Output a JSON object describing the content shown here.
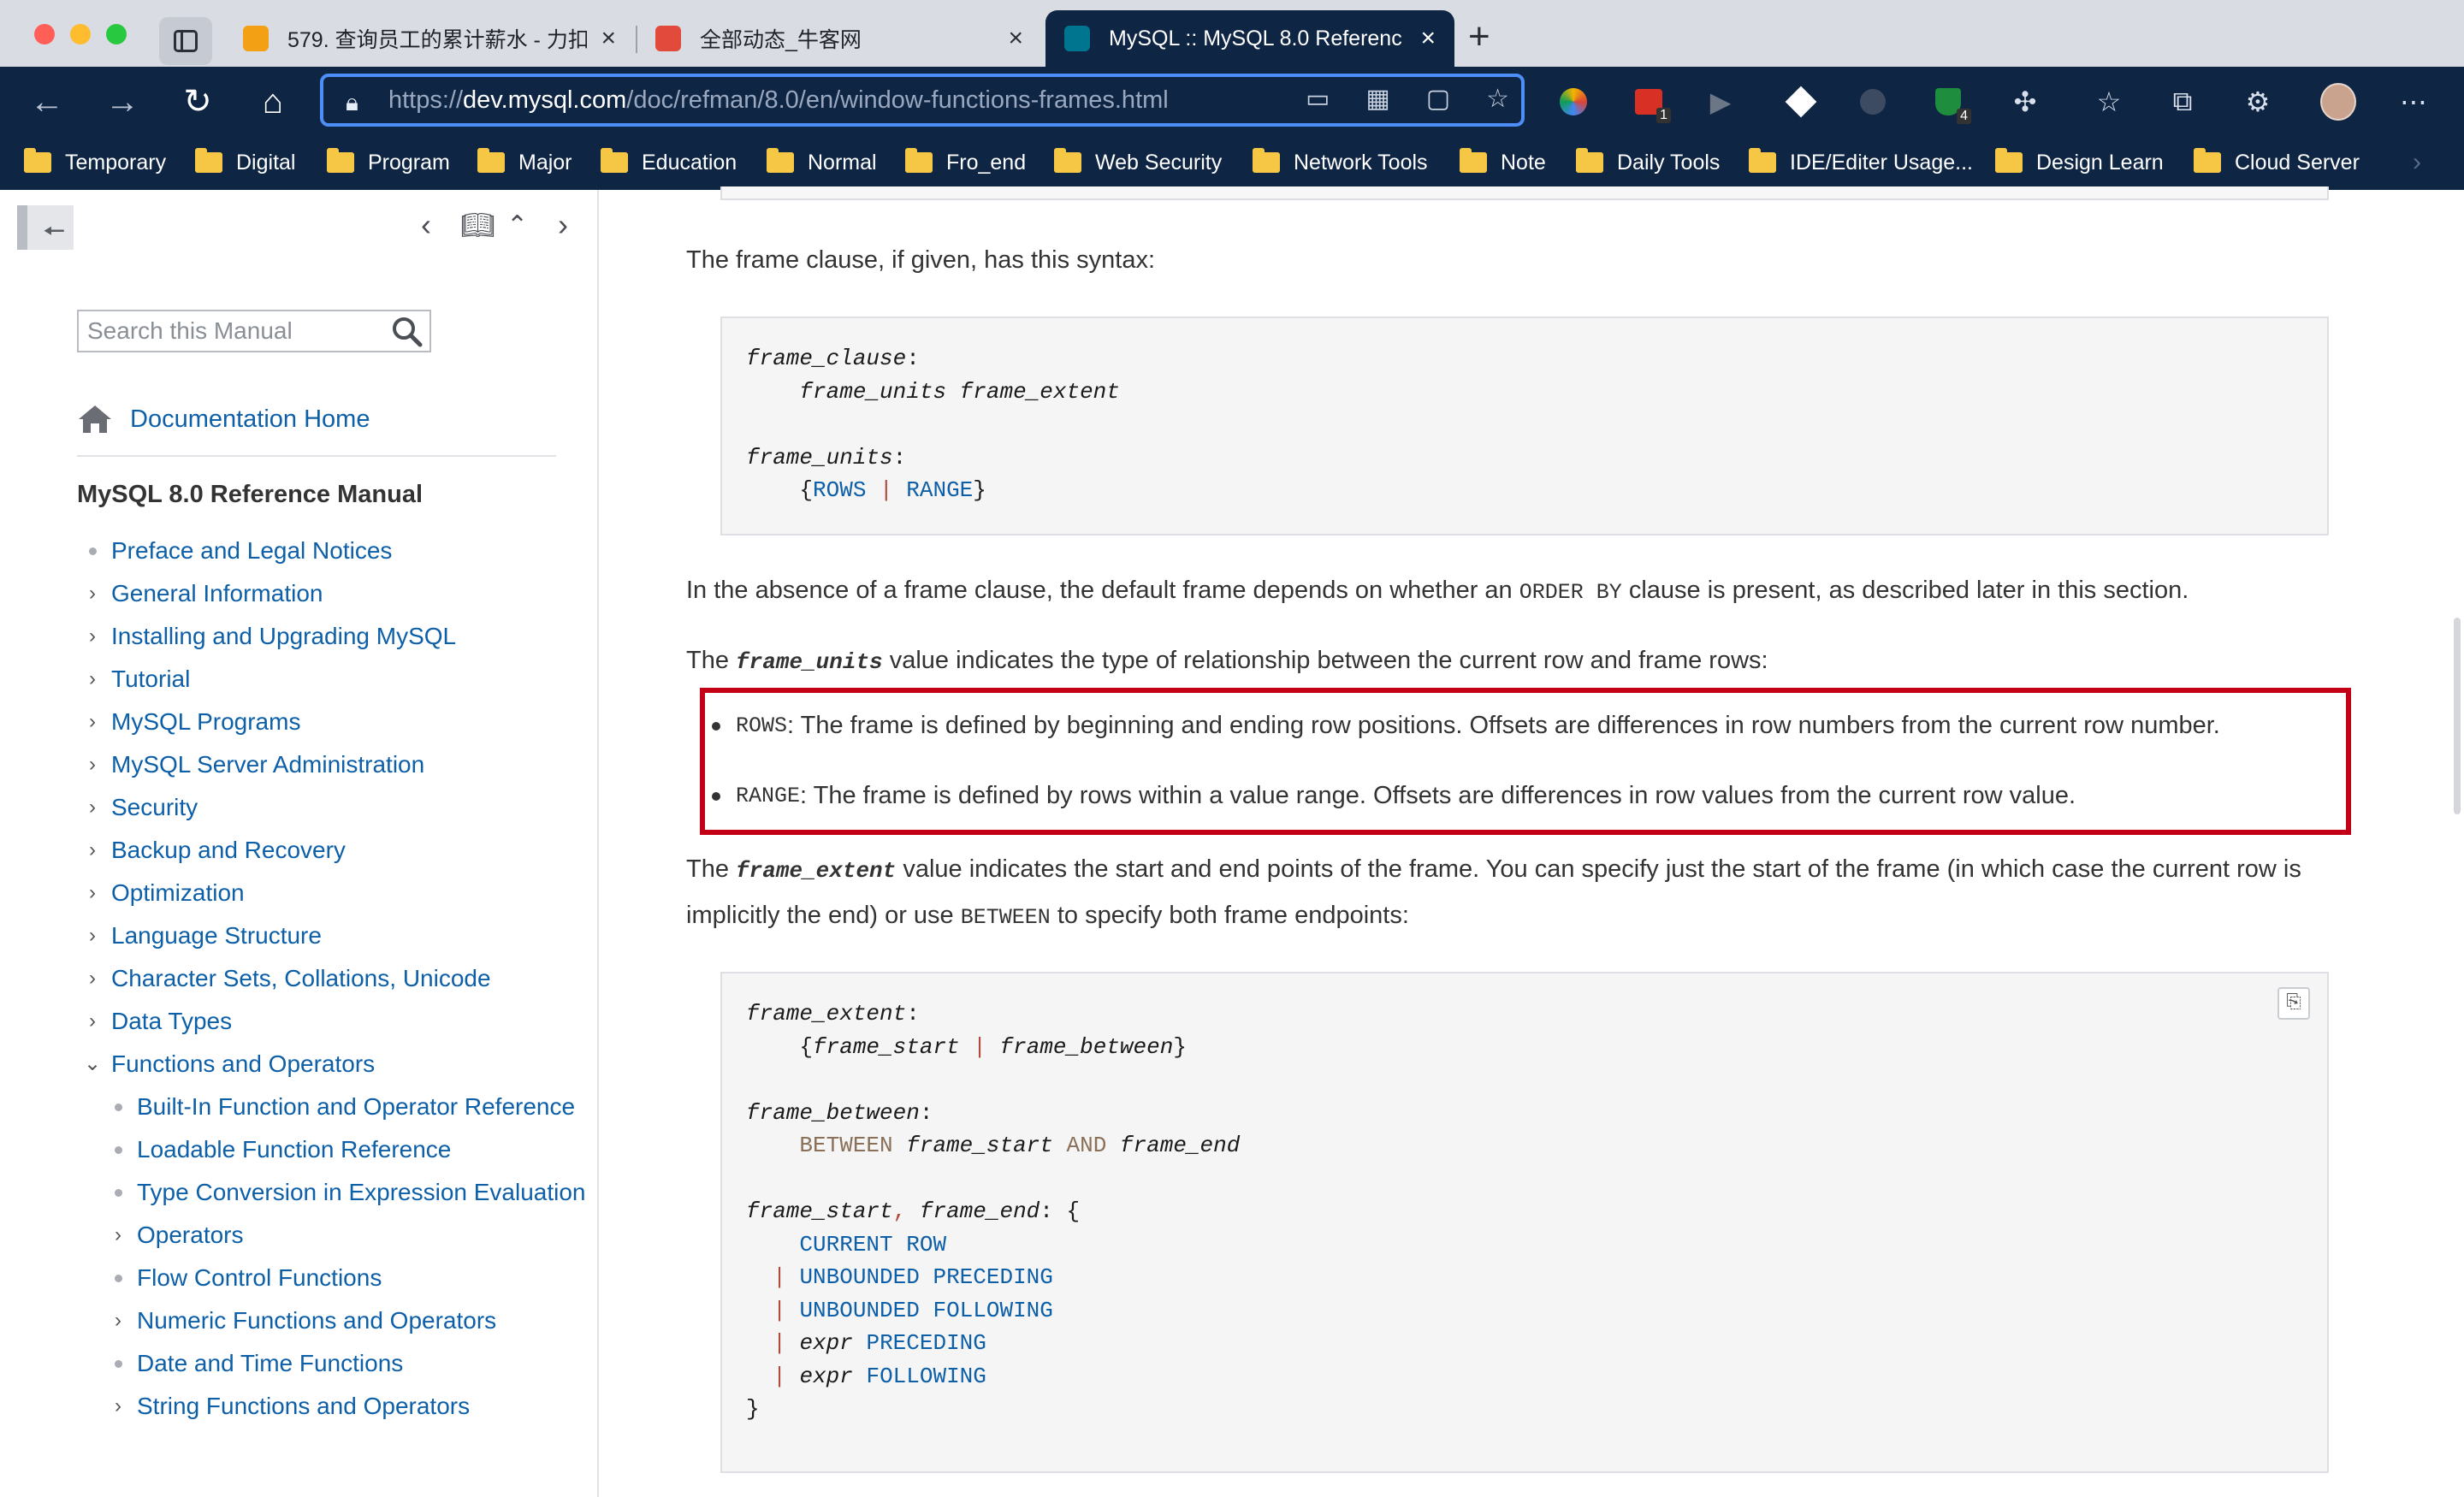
{
  "browser": {
    "tabs": [
      {
        "title": "579. 查询员工的累计薪水 - 力扣",
        "active": false,
        "favicon_color": "#f3a014"
      },
      {
        "title": "全部动态_牛客网",
        "active": false,
        "favicon_color": "#e24b3b"
      },
      {
        "title": "MySQL :: MySQL 8.0 Referenc",
        "active": true,
        "favicon_color": "#00758f"
      }
    ],
    "url": {
      "prefix": "https://",
      "host": "dev.mysql.com",
      "path": "/doc/refman/8.0/en/window-functions-frames.html"
    },
    "bookmarks": [
      "Temporary",
      "Digital",
      "Program",
      "Major",
      "Education",
      "Normal",
      "Fro_end",
      "Web Security",
      "Network Tools",
      "Note",
      "Daily Tools",
      "IDE/Editer Usage...",
      "Design Learn",
      "Cloud Server"
    ],
    "extension_badges": [
      "1",
      "4"
    ]
  },
  "sidebar": {
    "search_placeholder": "Search this Manual",
    "doc_home": "Documentation Home",
    "manual_title": "MySQL 8.0 Reference Manual",
    "toc": [
      {
        "label": "Preface and Legal Notices",
        "marker": "dot",
        "level": 0
      },
      {
        "label": "General Information",
        "marker": "chevron-right",
        "level": 0
      },
      {
        "label": "Installing and Upgrading MySQL",
        "marker": "chevron-right",
        "level": 0
      },
      {
        "label": "Tutorial",
        "marker": "chevron-right",
        "level": 0
      },
      {
        "label": "MySQL Programs",
        "marker": "chevron-right",
        "level": 0
      },
      {
        "label": "MySQL Server Administration",
        "marker": "chevron-right",
        "level": 0
      },
      {
        "label": "Security",
        "marker": "chevron-right",
        "level": 0
      },
      {
        "label": "Backup and Recovery",
        "marker": "chevron-right",
        "level": 0
      },
      {
        "label": "Optimization",
        "marker": "chevron-right",
        "level": 0
      },
      {
        "label": "Language Structure",
        "marker": "chevron-right",
        "level": 0
      },
      {
        "label": "Character Sets, Collations, Unicode",
        "marker": "chevron-right",
        "level": 0
      },
      {
        "label": "Data Types",
        "marker": "chevron-right",
        "level": 0
      },
      {
        "label": "Functions and Operators",
        "marker": "chevron-down",
        "level": 0
      },
      {
        "label": "Built-In Function and Operator Reference",
        "marker": "dot",
        "level": 1
      },
      {
        "label": "Loadable Function Reference",
        "marker": "dot",
        "level": 1
      },
      {
        "label": "Type Conversion in Expression Evaluation",
        "marker": "dot",
        "level": 1
      },
      {
        "label": "Operators",
        "marker": "chevron-right",
        "level": 1
      },
      {
        "label": "Flow Control Functions",
        "marker": "dot",
        "level": 1
      },
      {
        "label": "Numeric Functions and Operators",
        "marker": "chevron-right",
        "level": 1
      },
      {
        "label": "Date and Time Functions",
        "marker": "dot",
        "level": 1
      },
      {
        "label": "String Functions and Operators",
        "marker": "chevron-right",
        "level": 1
      }
    ]
  },
  "content": {
    "p1": "The frame clause, if given, has this syntax:",
    "code1": [
      "frame_clause:",
      "    frame_units frame_extent",
      "",
      "frame_units:",
      "    {ROWS | RANGE}"
    ],
    "p2_before": "In the absence of a frame clause, the default frame depends on whether an ",
    "p2_code": "ORDER BY",
    "p2_after": " clause is present, as described later in this section.",
    "p3_before": "The ",
    "p3_em": "frame_units",
    "p3_after": " value indicates the type of relationship between the current row and frame rows:",
    "bullet1_code": "ROWS",
    "bullet1_text": ": The frame is defined by beginning and ending row positions. Offsets are differences in row numbers from the current row number.",
    "bullet2_code": "RANGE",
    "bullet2_text": ": The frame is defined by rows within a value range. Offsets are differences in row values from the current row value.",
    "p4_before": "The ",
    "p4_em": "frame_extent",
    "p4_mid": " value indicates the start and end points of the frame. You can specify just the start of the frame (in which case the current row is implicitly the end) or use ",
    "p4_code": "BETWEEN",
    "p4_after": " to specify both frame endpoints:",
    "highlight_color": "#c40017"
  }
}
